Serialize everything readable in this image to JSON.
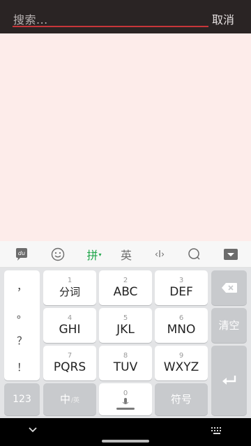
{
  "search": {
    "placeholder": "搜索...",
    "cancel_label": "取消"
  },
  "toolbar": {
    "items": [
      {
        "icon": "du-logo-icon",
        "label": "du"
      },
      {
        "icon": "emoji-icon"
      },
      {
        "label": "拼",
        "active": true
      },
      {
        "label": "英"
      },
      {
        "icon": "cursor-icon",
        "label": "‹I›"
      },
      {
        "icon": "search-icon"
      },
      {
        "icon": "collapse-keyboard-icon"
      }
    ]
  },
  "keyboard": {
    "punctuation": [
      "，",
      "。",
      "？",
      "！"
    ],
    "rows": [
      [
        {
          "num": "1",
          "label": "分词"
        },
        {
          "num": "2",
          "label": "ABC"
        },
        {
          "num": "3",
          "label": "DEF"
        }
      ],
      [
        {
          "num": "4",
          "label": "GHI"
        },
        {
          "num": "5",
          "label": "JKL"
        },
        {
          "num": "6",
          "label": "MNO"
        }
      ],
      [
        {
          "num": "7",
          "label": "PQRS"
        },
        {
          "num": "8",
          "label": "TUV"
        },
        {
          "num": "9",
          "label": "WXYZ"
        }
      ]
    ],
    "clear_label": "清空",
    "bottom": {
      "numbers_label": "123",
      "lang_label": "中",
      "lang_sub": "/英",
      "space_num": "0",
      "symbols_label": "符号"
    }
  },
  "colors": {
    "header_bg": "#2a2424",
    "accent_red": "#c8363a",
    "results_bg": "#fdecea",
    "pinyin_green": "#1fa64a"
  }
}
